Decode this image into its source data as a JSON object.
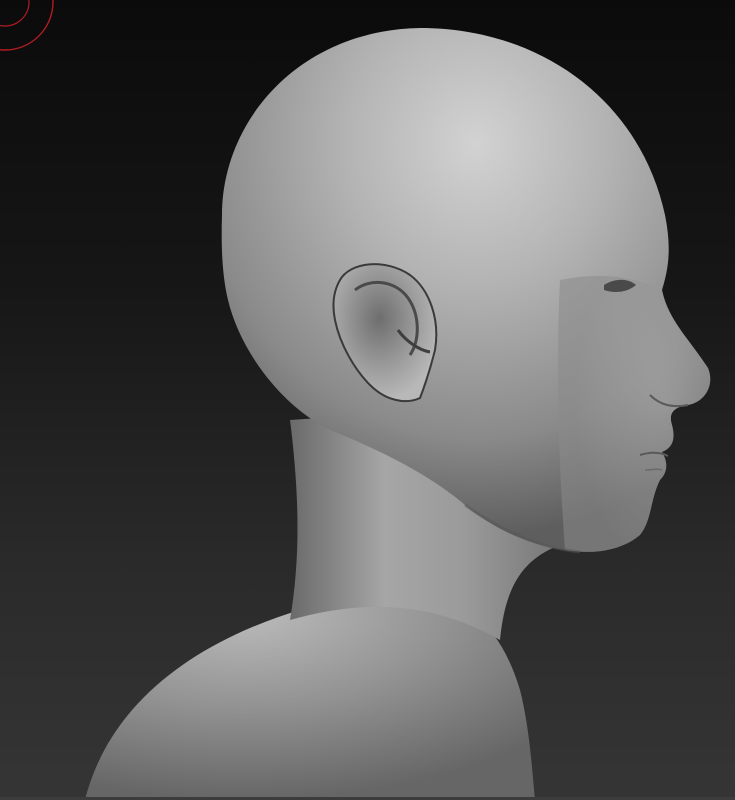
{
  "viewport": {
    "background_top": "#0b0b0b",
    "background_bottom": "#353535",
    "brush_cursor_color": "#c0202a",
    "model_color": "#9a9a9a",
    "model_highlight": "#d0d0d0",
    "model_shadow": "#3a3a3a"
  },
  "icons": {
    "brush_cursor": "brush-cursor-icon"
  }
}
